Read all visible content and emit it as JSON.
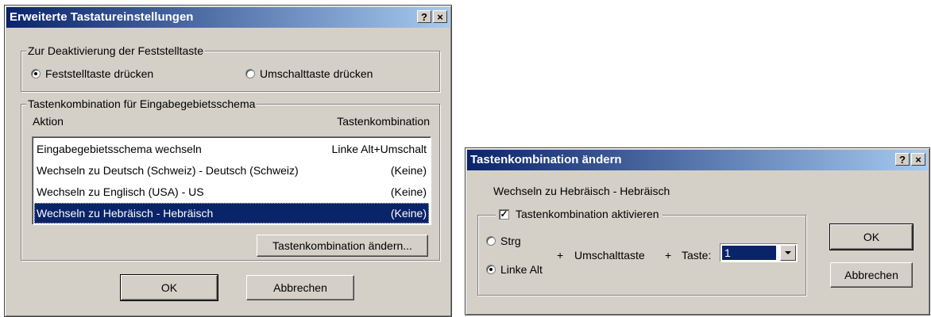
{
  "dialog1": {
    "title": "Erweiterte Tastatureinstellungen",
    "help": "?",
    "close": "×",
    "capslock_group": {
      "legend": "Zur Deaktivierung der Feststelltaste",
      "options": [
        {
          "label": "Feststelltaste drücken",
          "selected": true
        },
        {
          "label": "Umschalttaste drücken",
          "selected": false
        }
      ]
    },
    "hotkey_group": {
      "legend": "Tastenkombination für Eingabegebietsschema",
      "col_action": "Aktion",
      "col_keys": "Tastenkombination",
      "rows": [
        {
          "action": "Eingabegebietsschema wechseln",
          "keys": "Linke Alt+Umschalt"
        },
        {
          "action": "Wechseln zu Deutsch (Schweiz) - Deutsch (Schweiz)",
          "keys": "(Keine)"
        },
        {
          "action": "Wechseln zu Englisch (USA) - US",
          "keys": "(Keine)"
        },
        {
          "action": "Wechseln zu Hebräisch - Hebräisch",
          "keys": "(Keine)"
        }
      ],
      "change_button": "Tastenkombination ändern..."
    },
    "ok": "OK",
    "cancel": "Abbrechen"
  },
  "dialog2": {
    "title": "Tastenkombination ändern",
    "help": "?",
    "close": "×",
    "subject": "Wechseln zu Hebräisch - Hebräisch",
    "enable_label": "Tastenkombination aktivieren",
    "enable_checked": true,
    "mod_options": [
      {
        "label": "Strg",
        "selected": false
      },
      {
        "label": "Linke Alt",
        "selected": true
      }
    ],
    "plus1": "+",
    "shift_label": "Umschalttaste",
    "plus2": "+",
    "key_label": "Taste:",
    "key_value": "1",
    "ok": "OK",
    "cancel": "Abbrechen"
  }
}
